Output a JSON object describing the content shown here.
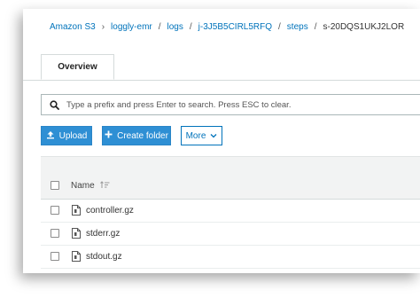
{
  "breadcrumb": {
    "items": [
      "Amazon S3",
      "loggly-emr",
      "logs",
      "j-3J5B5CIRL5RFQ",
      "steps"
    ],
    "current": "s-20DQS1UKJ2LOR",
    "separator": "›",
    "sep_alt": "/"
  },
  "tabs": [
    {
      "label": "Overview",
      "active": true
    }
  ],
  "search": {
    "placeholder": "Type a prefix and press Enter to search. Press ESC to clear.",
    "value": "",
    "icon": "search-icon"
  },
  "actions": {
    "upload_label": "Upload",
    "create_folder_label": "Create folder",
    "more_label": "More"
  },
  "table": {
    "column_name": "Name",
    "rows": [
      {
        "name": "controller.gz",
        "icon": "file-icon"
      },
      {
        "name": "stderr.gz",
        "icon": "file-icon"
      },
      {
        "name": "stdout.gz",
        "icon": "file-icon"
      }
    ]
  },
  "colors": {
    "accent": "#0073bb",
    "primary_button": "#2e8fd4",
    "header_bg": "#f2f3f3"
  }
}
